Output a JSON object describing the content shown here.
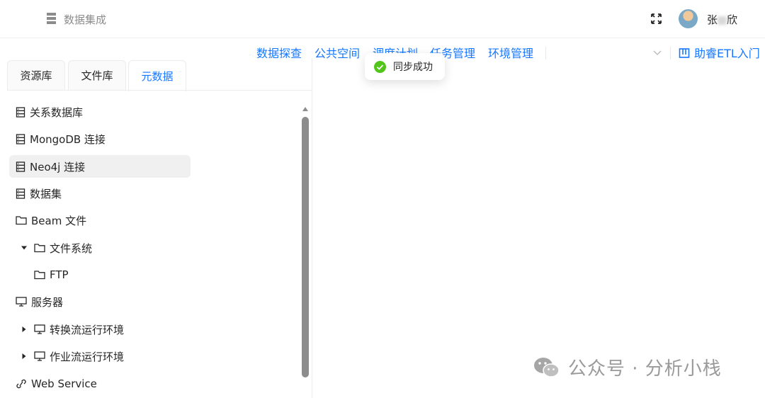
{
  "app": {
    "title": "数据集成",
    "username_prefix": "张",
    "username_suffix": "欣"
  },
  "nav": {
    "items": [
      "数据探查",
      "公共空间",
      "调度计划",
      "任务管理",
      "环境管理"
    ],
    "help": "助睿ETL入门"
  },
  "toast": {
    "text": "同步成功"
  },
  "tabs": [
    "资源库",
    "文件库",
    "元数据"
  ],
  "tree": [
    {
      "label": "关系数据库",
      "icon": "database-icon"
    },
    {
      "label": "MongoDB 连接",
      "icon": "database-icon"
    },
    {
      "label": "Neo4j 连接",
      "icon": "database-icon",
      "selected": true
    },
    {
      "label": "数据集",
      "icon": "database-icon"
    },
    {
      "label": "Beam 文件",
      "icon": "folder-icon"
    },
    {
      "label": "文件系统",
      "icon": "folder-icon",
      "expanded": true
    },
    {
      "label": "FTP",
      "icon": "folder-icon",
      "child": true
    },
    {
      "label": "服务器",
      "icon": "monitor-icon"
    },
    {
      "label": "转换流运行环境",
      "icon": "monitor-icon",
      "collapsed": true
    },
    {
      "label": "作业流运行环境",
      "icon": "monitor-icon",
      "collapsed": true
    },
    {
      "label": "Web Service",
      "icon": "link-icon"
    }
  ],
  "watermark": {
    "text": "公众号 · 分析小栈"
  }
}
